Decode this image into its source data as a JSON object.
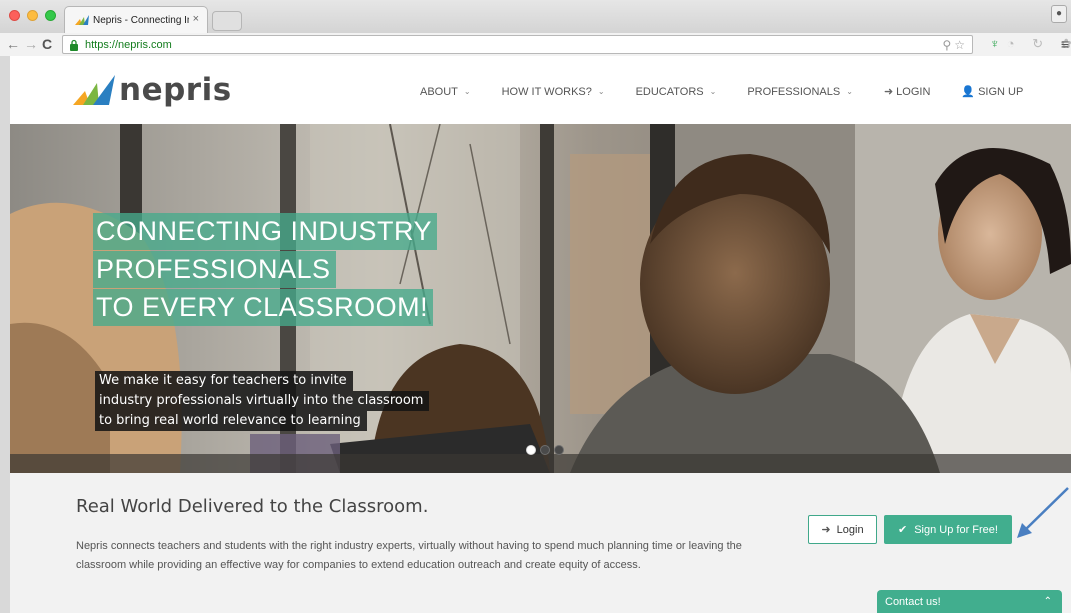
{
  "browser": {
    "tab_title": "Nepris - Connecting Indust",
    "tab_close": "×",
    "url": "https://nepris.com",
    "back": "←",
    "forward": "→",
    "reload": "C",
    "omni_icons": "⚲☆",
    "menu": "≡",
    "ext_a": "♆",
    "ext_b": "◔ ↻ ✿"
  },
  "header": {
    "logo_text": "nepris",
    "nav": [
      {
        "label": "ABOUT",
        "chevron": "⌄"
      },
      {
        "label": "HOW IT WORKS?",
        "chevron": "⌄"
      },
      {
        "label": "EDUCATORS",
        "chevron": "⌄"
      },
      {
        "label": "PROFESSIONALS",
        "chevron": "⌄"
      }
    ],
    "login": {
      "icon": "➜",
      "label": "LOGIN"
    },
    "signup": {
      "icon": "👤",
      "label": "SIGN UP"
    }
  },
  "hero": {
    "headline": [
      "CONNECTING INDUSTRY",
      "PROFESSIONALS",
      "TO EVERY CLASSROOM!"
    ],
    "subline": [
      "We make it easy for teachers to invite",
      "industry professionals virtually into the classroom",
      "to bring real world relevance to learning"
    ],
    "slides": 3,
    "active_slide": 1
  },
  "content": {
    "title": "Real World Delivered to the Classroom.",
    "body": "Nepris connects teachers and students with the right industry experts, virtually without having to spend much planning time or leaving the classroom while providing an effective way for companies to extend education outreach and create equity of access.",
    "login_button": {
      "icon": "➜",
      "label": "Login"
    },
    "signup_button": {
      "icon": "✔",
      "label": "Sign Up for Free!"
    },
    "contact_label": "Contact us!",
    "contact_chevron": "⌃"
  },
  "colors": {
    "accent": "#41ae8e",
    "annotation_arrow": "#4a7fc1"
  }
}
